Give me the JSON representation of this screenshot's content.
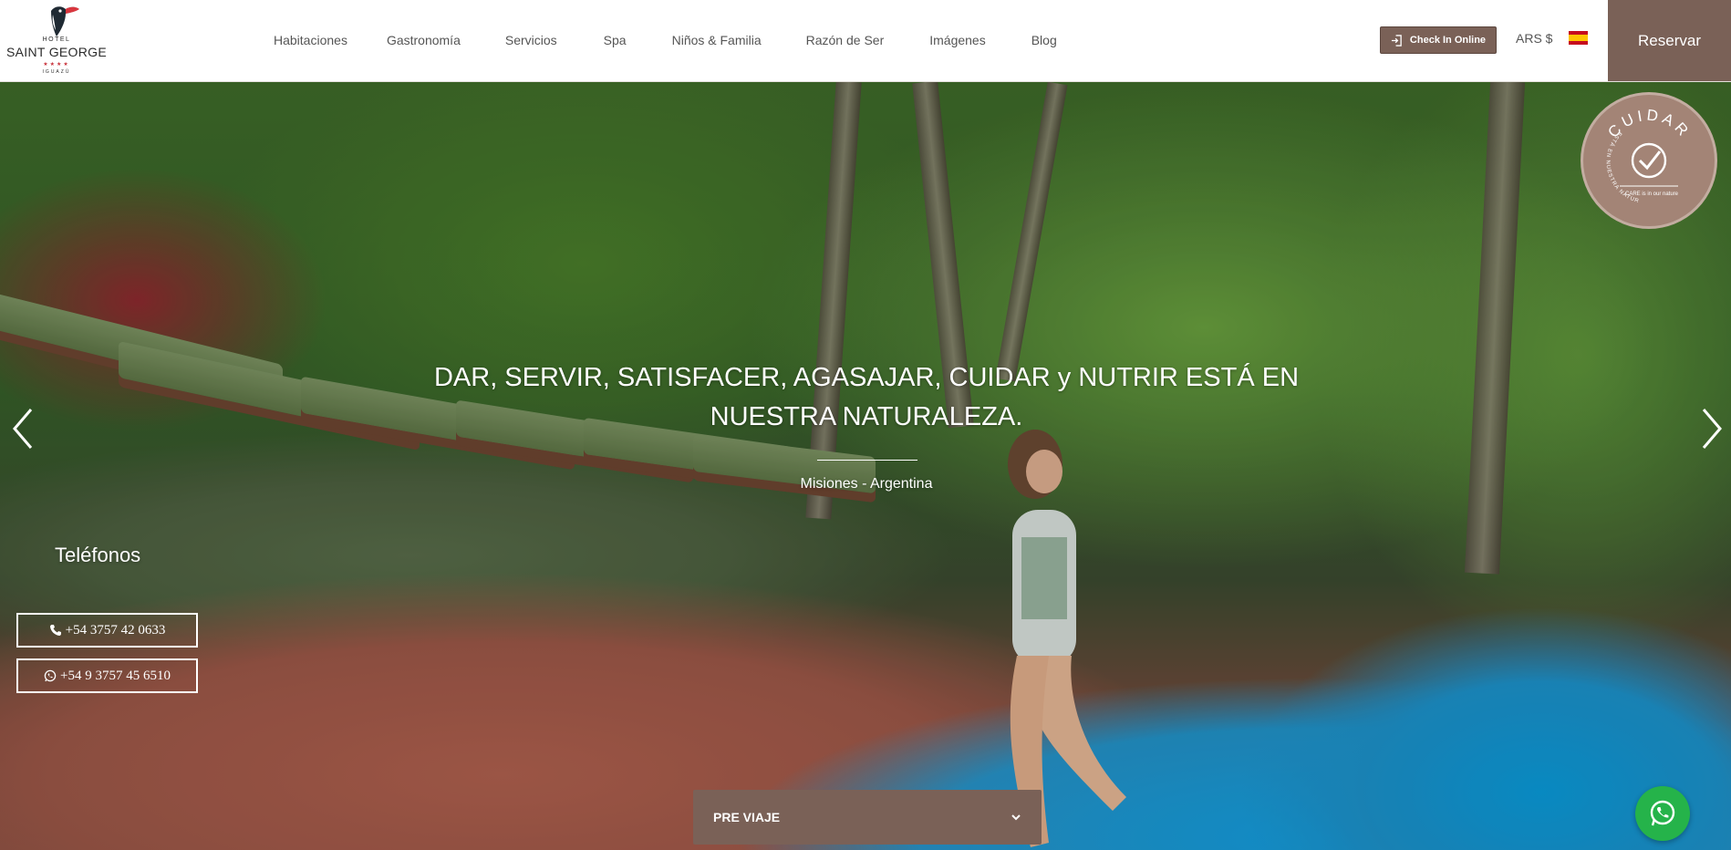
{
  "header": {
    "logo": {
      "hotel_label": "HOTEL",
      "name": "SAINT GEORGE",
      "stars": "★★★★",
      "location": "IGUAZÚ"
    },
    "nav": [
      {
        "label": "Habitaciones"
      },
      {
        "label": "Gastronomía"
      },
      {
        "label": "Servicios"
      },
      {
        "label": "Spa"
      },
      {
        "label": "Niños & Familia"
      },
      {
        "label": "Razón de Ser"
      },
      {
        "label": "Imágenes"
      },
      {
        "label": "Blog"
      }
    ],
    "checkin_label": "Check In Online",
    "currency": "ARS $",
    "language_flag": "spain-flag",
    "reservar_label": "Reservar"
  },
  "hero": {
    "heading": "DAR, SERVIR, SATISFACER, AGASAJAR, CUIDAR y NUTRIR ESTÁ EN NUESTRA NATURALEZA.",
    "location": "Misiones - Argentina",
    "badge": {
      "title": "CUIDAR",
      "arc_text": "ESTÁ EN NUESTRA NATURALEZA",
      "tagline": "CARE is in our nature"
    }
  },
  "phones": {
    "title": "Teléfonos",
    "landline": "+54 3757 42 0633",
    "whatsapp": "+54 9 3757 45 6510"
  },
  "pre_viaje": {
    "label": "PRE VIAJE"
  },
  "colors": {
    "brand_brown": "#7a6157",
    "whatsapp_green": "#25b34a"
  }
}
